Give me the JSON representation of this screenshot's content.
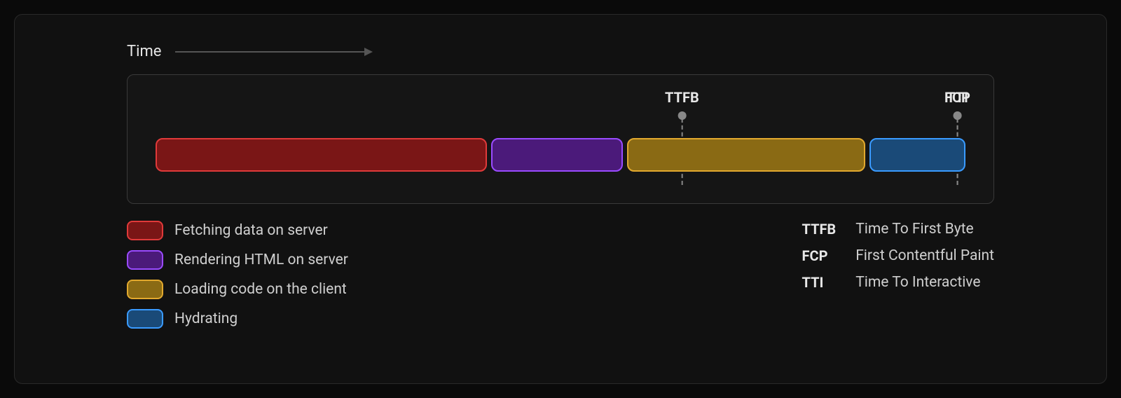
{
  "time_label": "Time",
  "markers": [
    {
      "short": "TTFB"
    },
    {
      "short": "FCP"
    },
    {
      "short": "TTI"
    }
  ],
  "bars": [
    {
      "key": "fetch",
      "label": "Fetching data on server"
    },
    {
      "key": "render",
      "label": "Rendering HTML on server"
    },
    {
      "key": "load",
      "label": "Loading code on the client"
    },
    {
      "key": "hydrate",
      "label": "Hydrating"
    }
  ],
  "definitions": [
    {
      "abbr": "TTFB",
      "desc": "Time To First Byte"
    },
    {
      "abbr": "FCP",
      "desc": "First Contentful Paint"
    },
    {
      "abbr": "TTI",
      "desc": "Time To Interactive"
    }
  ],
  "chart_data": {
    "type": "bar",
    "orientation": "horizontal-stacked-timeline",
    "title": "",
    "xlabel": "Time",
    "series": [
      {
        "name": "Fetching data on server",
        "duration_pct": 46,
        "start_pct": 0
      },
      {
        "name": "Rendering HTML on server",
        "duration_pct": 18,
        "start_pct": 46
      },
      {
        "name": "Loading code on the client",
        "duration_pct": 33,
        "start_pct": 64
      },
      {
        "name": "Hydrating",
        "duration_pct": 13,
        "start_pct": 97
      }
    ],
    "markers": [
      {
        "name": "TTFB",
        "at_pct": 64
      },
      {
        "name": "FCP",
        "at_pct": 97
      },
      {
        "name": "TTI",
        "at_pct": 110
      }
    ],
    "xlim_pct": [
      0,
      110
    ]
  }
}
